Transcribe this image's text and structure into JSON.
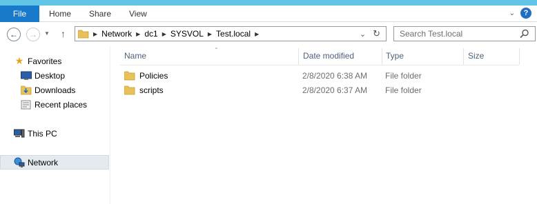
{
  "ribbon": {
    "file_tab": "File",
    "tabs": [
      "Home",
      "Share",
      "View"
    ]
  },
  "navigation": {
    "breadcrumbs": [
      "Network",
      "dc1",
      "SYSVOL",
      "Test.local"
    ],
    "search_placeholder": "Search Test.local"
  },
  "sidebar": {
    "favorites_label": "Favorites",
    "favorites": [
      {
        "label": "Desktop",
        "icon": "desktop-icon"
      },
      {
        "label": "Downloads",
        "icon": "downloads-icon"
      },
      {
        "label": "Recent places",
        "icon": "recent-places-icon"
      }
    ],
    "this_pc_label": "This PC",
    "network_label": "Network"
  },
  "columns": {
    "name": "Name",
    "date_modified": "Date modified",
    "type": "Type",
    "size": "Size"
  },
  "files": [
    {
      "name": "Policies",
      "date_modified": "2/8/2020 6:38 AM",
      "type": "File folder",
      "size": ""
    },
    {
      "name": "scripts",
      "date_modified": "2/8/2020 6:37 AM",
      "type": "File folder",
      "size": ""
    }
  ],
  "colors": {
    "file_tab": "#1979ca",
    "title_strip": "#5fc4e6",
    "header_text": "#4c607a",
    "selection": "#e5eaf0",
    "folder": "#e8c15a"
  }
}
